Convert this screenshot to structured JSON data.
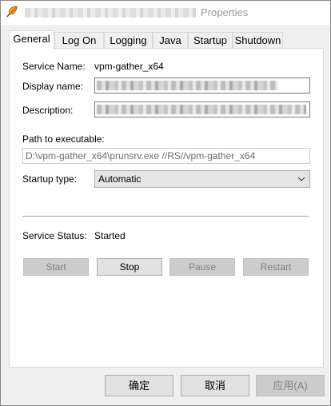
{
  "window": {
    "title": "Properties"
  },
  "tabs": [
    {
      "label": "General",
      "active": true
    },
    {
      "label": "Log On",
      "active": false
    },
    {
      "label": "Logging",
      "active": false
    },
    {
      "label": "Java",
      "active": false
    },
    {
      "label": "Startup",
      "active": false
    },
    {
      "label": "Shutdown",
      "active": false
    }
  ],
  "general": {
    "service_name_label": "Service Name:",
    "service_name_value": "vpm-gather_x64",
    "display_name_label": "Display name:",
    "description_label": "Description:",
    "path_label": "Path to executable:",
    "path_value": "D:\\vpm-gather_x64\\prunsrv.exe //RS//vpm-gather_x64",
    "startup_type_label": "Startup type:",
    "startup_type_value": "Automatic",
    "status_label": "Service Status:",
    "status_value": "Started"
  },
  "service_buttons": {
    "start": "Start",
    "stop": "Stop",
    "pause": "Pause",
    "restart": "Restart"
  },
  "dialog_buttons": {
    "ok": "确定",
    "cancel": "取消",
    "apply": "应用(A)"
  },
  "icons": {
    "app": "feather-app-icon",
    "dropdown": "chevron-down-icon"
  }
}
